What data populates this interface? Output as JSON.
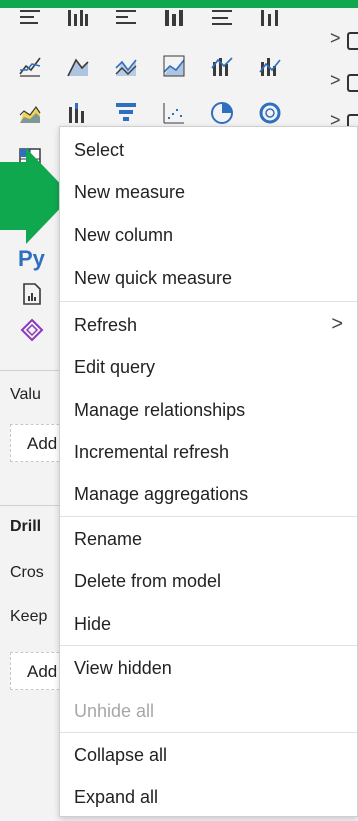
{
  "left_panel": {
    "fields_chevron": ">",
    "python_visual_label": "Py",
    "values_label": "Valu",
    "add_label_1": "Add",
    "drill_label": "Drill",
    "cross_label": "Cros",
    "keep_label": "Keep",
    "add_label_2": "Add"
  },
  "context_menu": {
    "items": [
      {
        "label": "Select",
        "enabled": true
      },
      {
        "label": "New measure",
        "enabled": true
      },
      {
        "label": "New column",
        "enabled": true
      },
      {
        "label": "New quick measure",
        "enabled": true
      },
      {
        "label": "Refresh",
        "enabled": true,
        "submenu": ">"
      },
      {
        "label": "Edit query",
        "enabled": true
      },
      {
        "label": "Manage relationships",
        "enabled": true
      },
      {
        "label": "Incremental refresh",
        "enabled": true
      },
      {
        "label": "Manage aggregations",
        "enabled": true
      },
      {
        "label": "Rename",
        "enabled": true
      },
      {
        "label": "Delete from model",
        "enabled": true
      },
      {
        "label": "Hide",
        "enabled": true
      },
      {
        "label": "View hidden",
        "enabled": true
      },
      {
        "label": "Unhide all",
        "enabled": false
      },
      {
        "label": "Collapse all",
        "enabled": true
      },
      {
        "label": "Expand all",
        "enabled": true
      }
    ]
  },
  "colors": {
    "accent_green": "#0fa84f",
    "icon_blue": "#2f6fbf",
    "icon_yellow": "#f2c811",
    "icon_purple": "#8a3ab9"
  },
  "icons": [
    "stacked-bar-icon",
    "clustered-bar-icon",
    "100-percent-bar-icon",
    "stacked-column-icon",
    "clustered-column-icon",
    "100-percent-column-icon",
    "line-chart-icon",
    "area-chart-icon",
    "stacked-area-icon",
    "line-stacked-column-icon",
    "line-clustered-column-icon",
    "ribbon-chart-icon",
    "waterfall-chart-icon",
    "funnel-icon",
    "scatter-chart-icon",
    "pie-chart-icon",
    "donut-chart-icon",
    "treemap-icon",
    "python-visual-icon",
    "paginated-report-icon",
    "power-apps-icon"
  ]
}
